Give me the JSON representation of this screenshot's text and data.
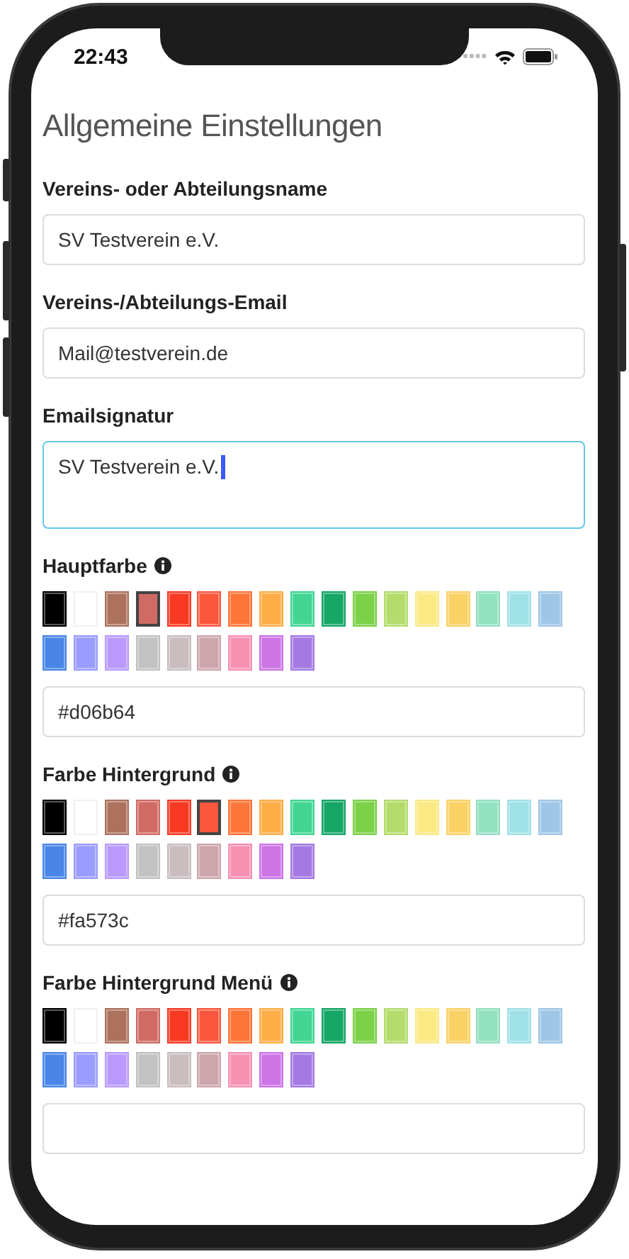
{
  "status_bar": {
    "time": "22:43"
  },
  "title": "Allgemeine Einstellungen",
  "fields": [
    {
      "kind": "input",
      "label": "Vereins- oder Abteilungsname",
      "info": false,
      "value": "SV Testverein e.V.",
      "focused": false
    },
    {
      "kind": "input",
      "label": "Vereins-/Abteilungs-Email",
      "info": false,
      "value": "Mail@testverein.de",
      "focused": false
    },
    {
      "kind": "textarea",
      "label": "Emailsignatur",
      "info": false,
      "value": "SV Testverein e.V.",
      "focused": true
    },
    {
      "kind": "palette",
      "label": "Hauptfarbe",
      "info": true,
      "value": "#d06b64",
      "focused": false,
      "swatches": [
        {
          "color": "#000000",
          "selected": false
        },
        {
          "color": "#ffffff",
          "selected": false
        },
        {
          "color": "#ac725e",
          "selected": false
        },
        {
          "color": "#d06b64",
          "selected": true
        },
        {
          "color": "#f83a22",
          "selected": false
        },
        {
          "color": "#fa573c",
          "selected": false
        },
        {
          "color": "#ff7537",
          "selected": false
        },
        {
          "color": "#ffad46",
          "selected": false
        },
        {
          "color": "#42d692",
          "selected": false
        },
        {
          "color": "#16a765",
          "selected": false
        },
        {
          "color": "#7bd148",
          "selected": false
        },
        {
          "color": "#b3dc6c",
          "selected": false
        },
        {
          "color": "#fbe983",
          "selected": false
        },
        {
          "color": "#fad165",
          "selected": false
        },
        {
          "color": "#92e1c0",
          "selected": false
        },
        {
          "color": "#9fe1e7",
          "selected": false
        },
        {
          "color": "#9fc6e7",
          "selected": false
        },
        {
          "color": "#4986e7",
          "selected": false
        },
        {
          "color": "#9a9cff",
          "selected": false
        },
        {
          "color": "#b99aff",
          "selected": false
        },
        {
          "color": "#c2c2c2",
          "selected": false
        },
        {
          "color": "#cabdbf",
          "selected": false
        },
        {
          "color": "#cca6ac",
          "selected": false
        },
        {
          "color": "#f691b2",
          "selected": false
        },
        {
          "color": "#cd74e6",
          "selected": false
        },
        {
          "color": "#a47ae2",
          "selected": false
        }
      ]
    },
    {
      "kind": "palette",
      "label": "Farbe Hintergrund",
      "info": true,
      "value": "#fa573c",
      "focused": false,
      "swatches": [
        {
          "color": "#000000",
          "selected": false
        },
        {
          "color": "#ffffff",
          "selected": false
        },
        {
          "color": "#ac725e",
          "selected": false
        },
        {
          "color": "#d06b64",
          "selected": false
        },
        {
          "color": "#f83a22",
          "selected": false
        },
        {
          "color": "#fa573c",
          "selected": true
        },
        {
          "color": "#ff7537",
          "selected": false
        },
        {
          "color": "#ffad46",
          "selected": false
        },
        {
          "color": "#42d692",
          "selected": false
        },
        {
          "color": "#16a765",
          "selected": false
        },
        {
          "color": "#7bd148",
          "selected": false
        },
        {
          "color": "#b3dc6c",
          "selected": false
        },
        {
          "color": "#fbe983",
          "selected": false
        },
        {
          "color": "#fad165",
          "selected": false
        },
        {
          "color": "#92e1c0",
          "selected": false
        },
        {
          "color": "#9fe1e7",
          "selected": false
        },
        {
          "color": "#9fc6e7",
          "selected": false
        },
        {
          "color": "#4986e7",
          "selected": false
        },
        {
          "color": "#9a9cff",
          "selected": false
        },
        {
          "color": "#b99aff",
          "selected": false
        },
        {
          "color": "#c2c2c2",
          "selected": false
        },
        {
          "color": "#cabdbf",
          "selected": false
        },
        {
          "color": "#cca6ac",
          "selected": false
        },
        {
          "color": "#f691b2",
          "selected": false
        },
        {
          "color": "#cd74e6",
          "selected": false
        },
        {
          "color": "#a47ae2",
          "selected": false
        }
      ]
    },
    {
      "kind": "palette",
      "label": "Farbe Hintergrund Menü",
      "info": true,
      "focused": false,
      "swatches": [
        {
          "color": "#000000",
          "selected": false
        },
        {
          "color": "#ffffff",
          "selected": false
        },
        {
          "color": "#ac725e",
          "selected": false
        },
        {
          "color": "#d06b64",
          "selected": false
        },
        {
          "color": "#f83a22",
          "selected": false
        },
        {
          "color": "#fa573c",
          "selected": false
        },
        {
          "color": "#ff7537",
          "selected": false
        },
        {
          "color": "#ffad46",
          "selected": false
        },
        {
          "color": "#42d692",
          "selected": false
        },
        {
          "color": "#16a765",
          "selected": false
        },
        {
          "color": "#7bd148",
          "selected": false
        },
        {
          "color": "#b3dc6c",
          "selected": false
        },
        {
          "color": "#fbe983",
          "selected": false
        },
        {
          "color": "#fad165",
          "selected": false
        },
        {
          "color": "#92e1c0",
          "selected": false
        },
        {
          "color": "#9fe1e7",
          "selected": false
        },
        {
          "color": "#9fc6e7",
          "selected": false
        },
        {
          "color": "#4986e7",
          "selected": false
        },
        {
          "color": "#9a9cff",
          "selected": false
        },
        {
          "color": "#b99aff",
          "selected": false
        },
        {
          "color": "#c2c2c2",
          "selected": false
        },
        {
          "color": "#cabdbf",
          "selected": false
        },
        {
          "color": "#cca6ac",
          "selected": false
        },
        {
          "color": "#f691b2",
          "selected": false
        },
        {
          "color": "#cd74e6",
          "selected": false
        },
        {
          "color": "#a47ae2",
          "selected": false
        }
      ]
    }
  ]
}
